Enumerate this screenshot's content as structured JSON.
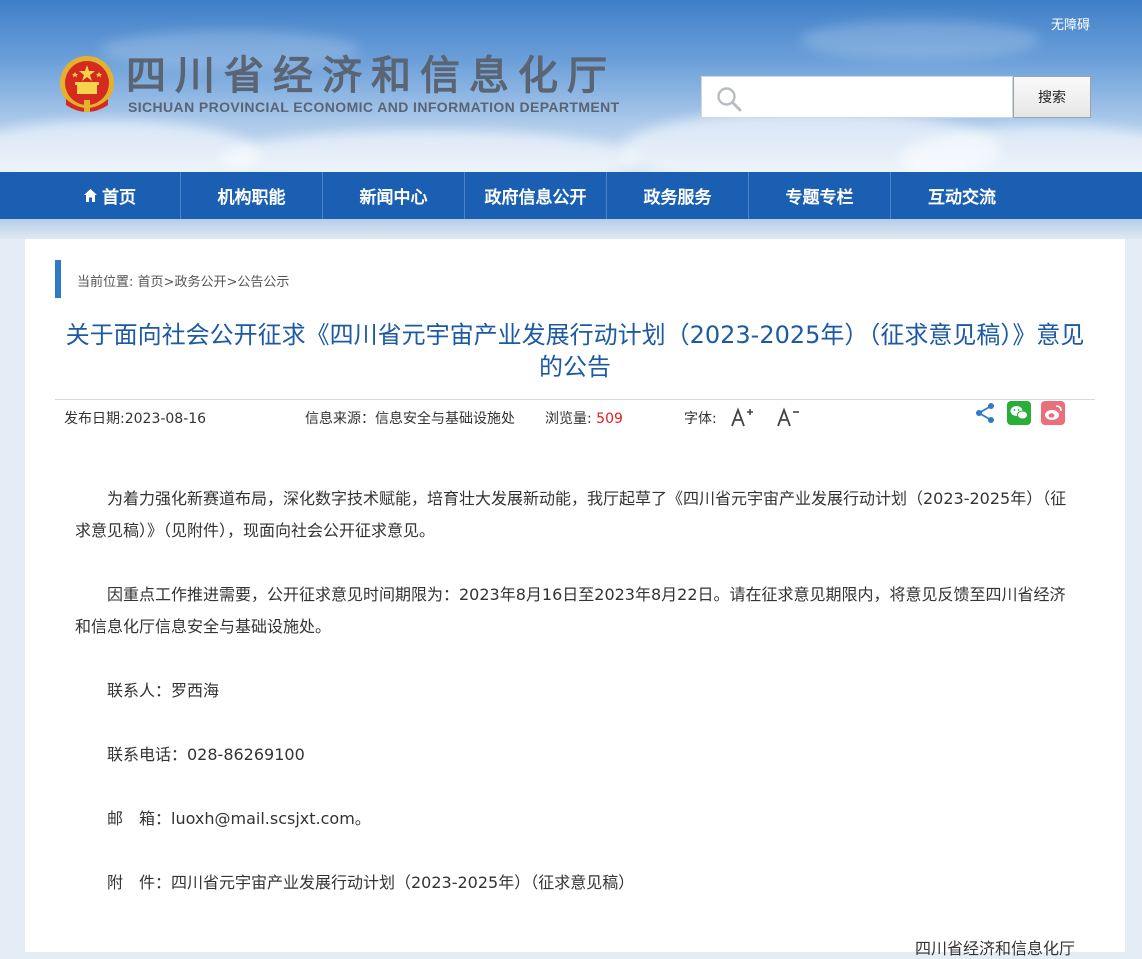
{
  "header": {
    "accessibility_link": "无障碍",
    "org_name_cn": "四川省经济和信息化厅",
    "org_name_en": "SICHUAN PROVINCIAL ECONOMIC AND INFORMATION DEPARTMENT",
    "search_placeholder": "",
    "search_button": "搜索"
  },
  "nav": {
    "items": [
      "首页",
      "机构职能",
      "新闻中心",
      "政府信息公开",
      "政务服务",
      "专题专栏",
      "互动交流"
    ]
  },
  "breadcrumb": {
    "prefix": "当前位置: ",
    "items": [
      "首页",
      "政务公开",
      "公告公示"
    ],
    "separator": ">"
  },
  "article": {
    "title": "关于面向社会公开征求《四川省元宇宙产业发展行动计划（2023-2025年）（征求意见稿）》意见的公告",
    "publish_date": "发布日期:2023-08-16",
    "source_label": "信息来源：",
    "source_value": "信息安全与基础设施处",
    "views_label": "浏览量: ",
    "views_value": "509",
    "font_label": "字体:",
    "paragraphs": [
      "为着力强化新赛道布局，深化数字技术赋能，培育壮大发展新动能，我厅起草了《四川省元宇宙产业发展行动计划（2023-2025年）（征求意见稿）》（见附件），现面向社会公开征求意见。",
      "因重点工作推进需要，公开征求意见时间期限为：2023年8月16日至2023年8月22日。请在征求意见期限内，将意见反馈至四川省经济和信息化厅信息安全与基础设施处。",
      "联系人：罗西海",
      "联系电话：028-86269100",
      "邮　箱：luoxh@mail.scsjxt.com。",
      "附　件：四川省元宇宙产业发展行动计划（2023-2025年）（征求意见稿）"
    ],
    "signature": "四川省经济和信息化厅"
  },
  "colors": {
    "nav_bg": "#1b5fb3",
    "title": "#1c5aa4",
    "accent_bar": "#2f7ac5",
    "views": "#e02020",
    "wechat": "#2aae3a",
    "weibo": "#e9707a"
  },
  "icons": {
    "home": "home-icon",
    "search": "search-icon",
    "font_increase": "font-increase-icon",
    "font_decrease": "font-decrease-icon",
    "share": "share-icon",
    "wechat": "wechat-icon",
    "weibo": "weibo-icon"
  }
}
